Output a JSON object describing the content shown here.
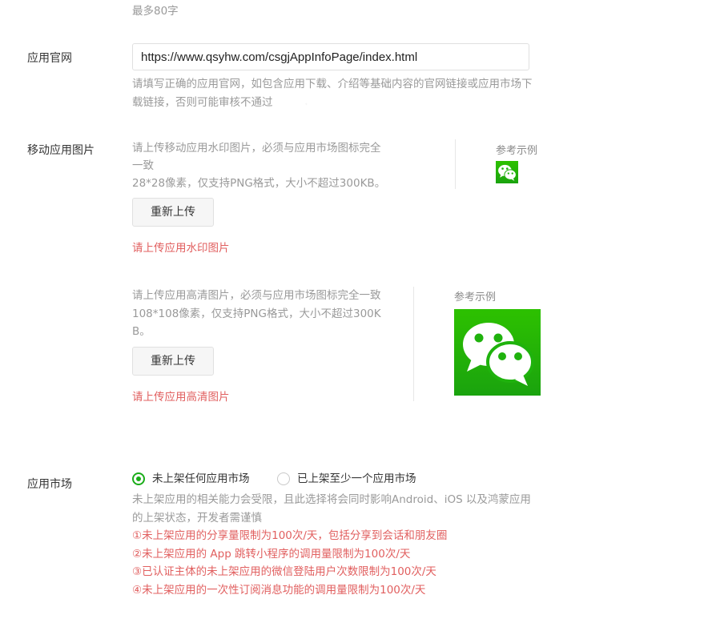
{
  "top_hint": "最多80字",
  "website": {
    "label": "应用官网",
    "value": "https://www.qsyhw.com/csgjAppInfoPage/index.html",
    "hint_line1": "请填写正确的应用官网，如包含应用下载、介绍等基础内容的官网链接或应用市场下",
    "hint_line2": "载链接，否则可能审核不通过"
  },
  "mobile_images": {
    "label": "移动应用图片",
    "watermark": {
      "desc_line1": "请上传移动应用水印图片，必须与应用市场图标完全",
      "desc_line2": "一致",
      "desc_line3": "28*28像素，仅支持PNG格式，大小不超过300KB。",
      "button": "重新上传",
      "error": "请上传应用水印图片",
      "ref_title": "参考示例",
      "ref_icon": "wechat-icon-small"
    },
    "hd": {
      "desc_line1": "请上传应用高清图片，必须与应用市场图标完全一致",
      "desc_line2": "108*108像素，仅支持PNG格式，大小不超过300K",
      "desc_line3": "B。",
      "button": "重新上传",
      "error": "请上传应用高清图片",
      "ref_title": "参考示例",
      "ref_icon": "wechat-icon-large"
    }
  },
  "market": {
    "label": "应用市场",
    "options": [
      {
        "label": "未上架任何应用市场",
        "selected": true
      },
      {
        "label": "已上架至少一个应用市场",
        "selected": false
      }
    ],
    "note_line1": "未上架应用的相关能力会受限，且此选择将会同时影响Android、iOS 以及鸿蒙应用",
    "note_line2": "的上架状态，开发者需谨慎",
    "limits": [
      "①未上架应用的分享量限制为100次/天，包括分享到会话和朋友圈",
      "②未上架应用的 App 跳转小程序的调用量限制为100次/天",
      "③已认证主体的未上架应用的微信登陆用户次数限制为100次/天",
      "④未上架应用的一次性订阅消息功能的调用量限制为100次/天"
    ]
  },
  "colors": {
    "accent_green": "#1aad19",
    "error_red": "#e15f5f",
    "muted_text": "#9a9a9a"
  }
}
